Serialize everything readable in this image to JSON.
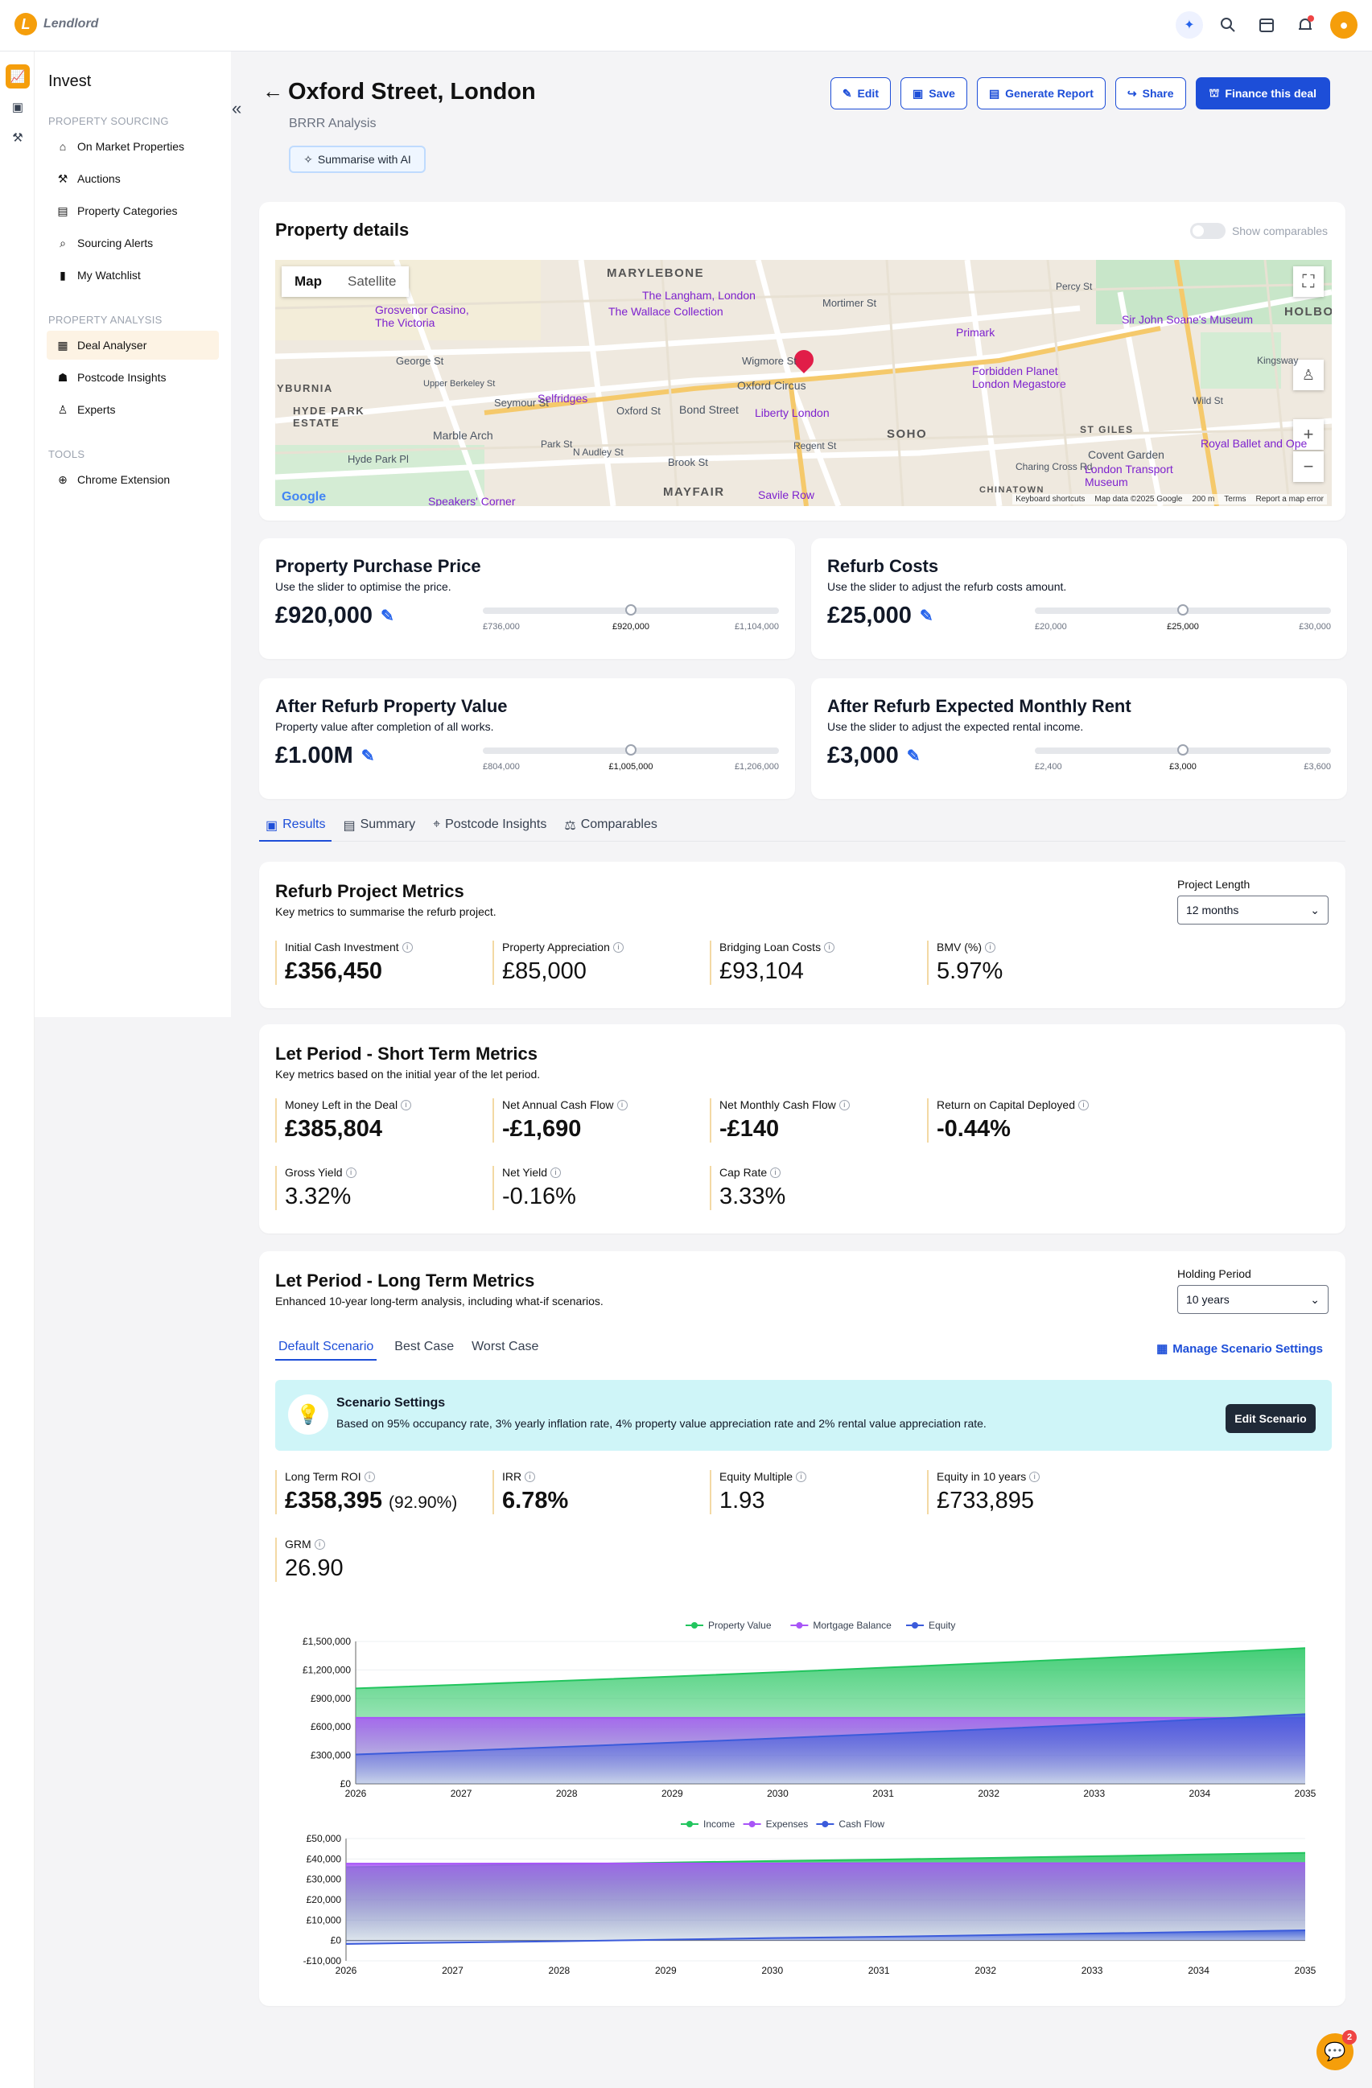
{
  "app": {
    "name": "Lendlord"
  },
  "topbar": {
    "icons": [
      "ai-sparkle-icon",
      "search-icon",
      "calendar-icon",
      "bell-icon",
      "user-icon"
    ]
  },
  "sidebar": {
    "title": "Invest",
    "sections": [
      {
        "label": "PROPERTY SOURCING",
        "items": [
          {
            "label": "On Market Properties",
            "icon": "home-icon"
          },
          {
            "label": "Auctions",
            "icon": "gavel-icon"
          },
          {
            "label": "Property Categories",
            "icon": "clipboard-icon"
          },
          {
            "label": "Sourcing Alerts",
            "icon": "search-icon"
          },
          {
            "label": "My Watchlist",
            "icon": "bookmark-icon"
          }
        ]
      },
      {
        "label": "PROPERTY ANALYSIS",
        "items": [
          {
            "label": "Deal Analyser",
            "icon": "calculator-icon",
            "active": true
          },
          {
            "label": "Postcode Insights",
            "icon": "users-icon"
          },
          {
            "label": "Experts",
            "icon": "person-icon"
          }
        ]
      },
      {
        "label": "TOOLS",
        "items": [
          {
            "label": "Chrome Extension",
            "icon": "globe-icon"
          }
        ]
      }
    ]
  },
  "header": {
    "title": "Oxford Street, London",
    "subtitle": "BRRR Analysis",
    "ai_button": "Summarise with AI",
    "actions": {
      "edit": "Edit",
      "save": "Save",
      "report": "Generate Report",
      "share": "Share",
      "finance": "Finance this deal"
    }
  },
  "property_details": {
    "title": "Property details",
    "toggle_label": "Show comparables",
    "map": {
      "tab_map": "Map",
      "tab_satellite": "Satellite",
      "labels": [
        "MARYLEBONE",
        "HOLBO",
        "HYDE PARK ESTATE",
        "SOHO",
        "ST GILES",
        "MAYFAIR",
        "CHINATOWN",
        "YBURNIA",
        "Oxford Circus",
        "Bond Street",
        "Selfridges",
        "Liberty London",
        "Primark",
        "Forbidden Planet London Megastore",
        "Sir John Soane's Museum",
        "The Langham, London",
        "The Wallace Collection",
        "Grosvenor Casino, The Victoria",
        "Covent Garden",
        "London Transport Museum",
        "Royal Ballet and Ope",
        "Savile Row",
        "Marble Arch",
        "Speakers' Corner",
        "Wigmore St",
        "George St",
        "Seymour St",
        "Oxford St",
        "Brook St",
        "Hyde Park Pl",
        "Upper Berkeley St",
        "Mortimer St",
        "Percy St",
        "Wild St",
        "Kingsway",
        "Park St",
        "N Audley St",
        "Regent St",
        "Charing Cross Rd"
      ],
      "google": "Google",
      "footer": [
        "Keyboard shortcuts",
        "Map data ©2025 Google",
        "200 m",
        "Terms",
        "Report a map error"
      ]
    }
  },
  "sliders": [
    {
      "title": "Property Purchase Price",
      "subtitle": "Use the slider to optimise the price.",
      "value": "£920,000",
      "min": "£736,000",
      "mid": "£920,000",
      "max": "£1,104,000",
      "position": 0.5
    },
    {
      "title": "Refurb Costs",
      "subtitle": "Use the slider to adjust the refurb costs amount.",
      "value": "£25,000",
      "min": "£20,000",
      "mid": "£25,000",
      "max": "£30,000",
      "position": 0.5
    },
    {
      "title": "After Refurb Property Value",
      "subtitle": "Property value after completion of all works.",
      "value": "£1.00M",
      "min": "£804,000",
      "mid": "£1,005,000",
      "max": "£1,206,000",
      "position": 0.5
    },
    {
      "title": "After Refurb Expected Monthly Rent",
      "subtitle": "Use the slider to adjust the expected rental income.",
      "value": "£3,000",
      "min": "£2,400",
      "mid": "£3,000",
      "max": "£3,600",
      "position": 0.5
    }
  ],
  "result_tabs": [
    "Results",
    "Summary",
    "Postcode Insights",
    "Comparables"
  ],
  "refurb": {
    "title": "Refurb Project Metrics",
    "subtitle": "Key metrics to summarise the refurb project.",
    "dropdown_label": "Project Length",
    "dropdown_value": "12 months",
    "metrics": [
      {
        "label": "Initial Cash Investment",
        "value": "£356,450"
      },
      {
        "label": "Property Appreciation",
        "value": "£85,000"
      },
      {
        "label": "Bridging Loan Costs",
        "value": "£93,104"
      },
      {
        "label": "BMV (%)",
        "value": "5.97%"
      }
    ]
  },
  "short_term": {
    "title": "Let Period - Short Term Metrics",
    "subtitle": "Key metrics based on the initial year of the let period.",
    "metrics": [
      {
        "label": "Money Left in the Deal",
        "value": "£385,804"
      },
      {
        "label": "Net Annual Cash Flow",
        "value": "-£1,690"
      },
      {
        "label": "Net Monthly Cash Flow",
        "value": "-£140"
      },
      {
        "label": "Return on Capital Deployed",
        "value": "-0.44%"
      },
      {
        "label": "Gross Yield",
        "value": "3.32%"
      },
      {
        "label": "Net Yield",
        "value": "-0.16%"
      },
      {
        "label": "Cap Rate",
        "value": "3.33%"
      }
    ]
  },
  "long_term": {
    "title": "Let Period - Long Term Metrics",
    "subtitle": "Enhanced 10-year long-term analysis, including what-if scenarios.",
    "dropdown_label": "Holding Period",
    "dropdown_value": "10 years",
    "tabs": [
      "Default Scenario",
      "Best Case",
      "Worst Case"
    ],
    "manage": "Manage Scenario Settings",
    "scenario_title": "Scenario Settings",
    "scenario_text": "Based on 95% occupancy rate, 3% yearly inflation rate, 4% property value appreciation rate and 2% rental value appreciation rate.",
    "edit_scenario": "Edit Scenario",
    "metrics": [
      {
        "label": "Long Term ROI",
        "value": "£358,395",
        "extra": "(92.90%)"
      },
      {
        "label": "IRR",
        "value": "6.78%"
      },
      {
        "label": "Equity Multiple",
        "value": "1.93"
      },
      {
        "label": "Equity in 10 years",
        "value": "£733,895"
      },
      {
        "label": "GRM",
        "value": "26.90"
      }
    ]
  },
  "chart_data": [
    {
      "type": "area",
      "x": [
        2026,
        2027,
        2028,
        2029,
        2030,
        2031,
        2032,
        2033,
        2034,
        2035
      ],
      "series": [
        {
          "name": "Property Value",
          "color": "#22c55e",
          "values": [
            1005000,
            1045000,
            1087000,
            1130000,
            1176000,
            1223000,
            1272000,
            1322000,
            1375000,
            1430000
          ]
        },
        {
          "name": "Mortgage Balance",
          "color": "#a855f7",
          "values": [
            696000,
            696000,
            696000,
            696000,
            696000,
            696000,
            696000,
            696000,
            696000,
            696000
          ]
        },
        {
          "name": "Equity",
          "color": "#3b5bdb",
          "values": [
            309000,
            349000,
            391000,
            434000,
            480000,
            527000,
            576000,
            626000,
            679000,
            734000
          ]
        }
      ],
      "yticks": [
        "£0",
        "£300,000",
        "£600,000",
        "£900,000",
        "£1,200,000",
        "£1,500,000"
      ],
      "ylim": [
        0,
        1500000
      ]
    },
    {
      "type": "area",
      "x": [
        2026,
        2027,
        2028,
        2029,
        2030,
        2031,
        2032,
        2033,
        2034,
        2035
      ],
      "series": [
        {
          "name": "Income",
          "color": "#22c55e",
          "values": [
            36000,
            36700,
            37400,
            38200,
            39000,
            39700,
            40500,
            41300,
            42200,
            43000
          ]
        },
        {
          "name": "Expenses",
          "color": "#a855f7",
          "values": [
            37700,
            37700,
            37800,
            37800,
            37800,
            37900,
            37900,
            37900,
            38000,
            38000
          ]
        },
        {
          "name": "Cash Flow",
          "color": "#3b5bdb",
          "values": [
            -1690,
            -1000,
            -400,
            400,
            1200,
            1800,
            2600,
            3400,
            4200,
            5000
          ]
        }
      ],
      "yticks": [
        "-£10,000",
        "£0",
        "£10,000",
        "£20,000",
        "£30,000",
        "£40,000",
        "£50,000"
      ],
      "ylim": [
        -10000,
        50000
      ]
    }
  ]
}
